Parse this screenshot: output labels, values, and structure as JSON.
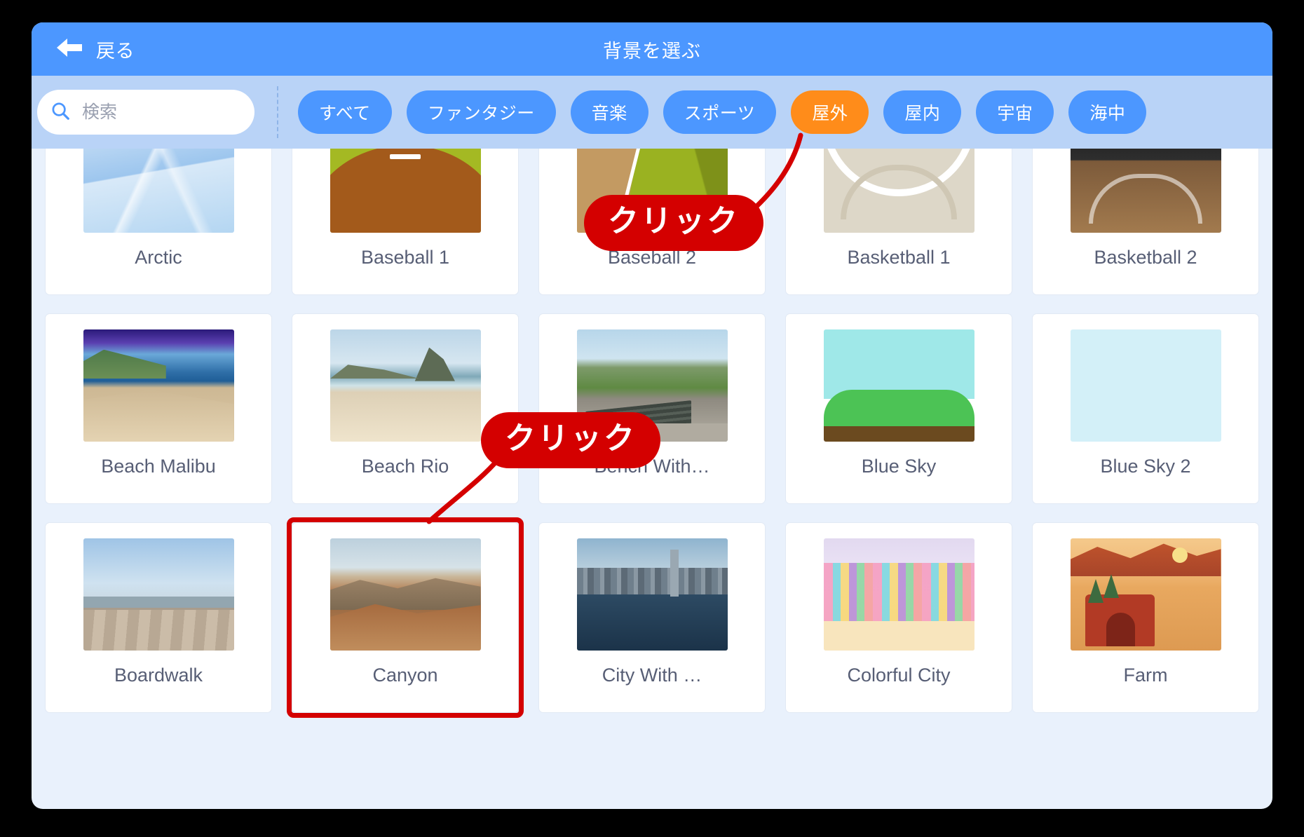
{
  "header": {
    "back_label": "戻る",
    "back_icon": "arrow-left-icon",
    "title": "背景を選ぶ"
  },
  "search": {
    "placeholder": "検索",
    "value": "",
    "icon": "search-icon"
  },
  "tabs": [
    {
      "label": "すべて",
      "active": false
    },
    {
      "label": "ファンタジー",
      "active": false
    },
    {
      "label": "音楽",
      "active": false
    },
    {
      "label": "スポーツ",
      "active": false
    },
    {
      "label": "屋外",
      "active": true
    },
    {
      "label": "屋内",
      "active": false
    },
    {
      "label": "宇宙",
      "active": false
    },
    {
      "label": "海中",
      "active": false
    }
  ],
  "cards": [
    {
      "label": "Arctic",
      "thumb": "t-arctic",
      "selected": false
    },
    {
      "label": "Baseball 1",
      "thumb": "t-baseball1",
      "selected": false
    },
    {
      "label": "Baseball 2",
      "thumb": "t-baseball2",
      "selected": false
    },
    {
      "label": "Basketball 1",
      "thumb": "t-basketball1",
      "selected": false
    },
    {
      "label": "Basketball 2",
      "thumb": "t-basketball2",
      "selected": false
    },
    {
      "label": "Beach Malibu",
      "thumb": "t-beachmalibu",
      "selected": false
    },
    {
      "label": "Beach Rio",
      "thumb": "t-beachrio",
      "selected": false
    },
    {
      "label": "Bench With…",
      "thumb": "t-bench",
      "selected": false
    },
    {
      "label": "Blue Sky",
      "thumb": "t-bluesky",
      "selected": false
    },
    {
      "label": "Blue Sky 2",
      "thumb": "t-bluesky2",
      "selected": false
    },
    {
      "label": "Boardwalk",
      "thumb": "t-boardwalk",
      "selected": false
    },
    {
      "label": "Canyon",
      "thumb": "t-canyon",
      "selected": true
    },
    {
      "label": "City With …",
      "thumb": "t-citywith",
      "selected": false
    },
    {
      "label": "Colorful City",
      "thumb": "t-colorfulcity",
      "selected": false
    },
    {
      "label": "Farm",
      "thumb": "t-farm",
      "selected": false
    }
  ],
  "callouts": [
    {
      "text": "クリック",
      "target": "屋外"
    },
    {
      "text": "クリック",
      "target": "Canyon"
    }
  ],
  "colors": {
    "header_blue": "#4c97ff",
    "filterbar_blue": "#b9d3f7",
    "active_tab_orange": "#ff8c1a",
    "callout_red": "#d40000",
    "label_text": "#575e75",
    "page_bg": "#e9f1fc"
  }
}
